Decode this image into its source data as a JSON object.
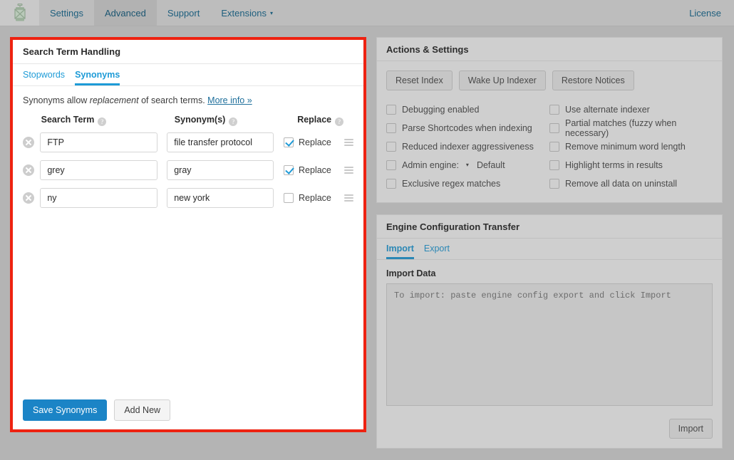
{
  "topbar": {
    "logo_icon": "lantern-icon",
    "tabs": [
      {
        "label": "Settings",
        "active": false
      },
      {
        "label": "Advanced",
        "active": true
      },
      {
        "label": "Support",
        "active": false
      },
      {
        "label": "Extensions",
        "active": false,
        "caret": "▾"
      }
    ],
    "license_label": "License"
  },
  "left_panel": {
    "title": "Search Term Handling",
    "subtabs": [
      {
        "label": "Stopwords",
        "active": false
      },
      {
        "label": "Synonyms",
        "active": true
      }
    ],
    "description_before": "Synonyms allow ",
    "description_em": "replacement",
    "description_after": " of search terms. ",
    "more_info_label": "More info »",
    "columns": {
      "term": "Search Term",
      "synonym": "Synonym(s)",
      "replace": "Replace",
      "help_glyph": "?"
    },
    "rows": [
      {
        "term": "FTP",
        "synonym": "file transfer protocol",
        "replace_label": "Replace",
        "replace_checked": true,
        "remove_icon": "remove-circle-icon",
        "drag_icon": "drag-handle-icon"
      },
      {
        "term": "grey",
        "synonym": "gray",
        "replace_label": "Replace",
        "replace_checked": true,
        "remove_icon": "remove-circle-icon",
        "drag_icon": "drag-handle-icon"
      },
      {
        "term": "ny",
        "synonym": "new york",
        "replace_label": "Replace",
        "replace_checked": false,
        "remove_icon": "remove-circle-icon",
        "drag_icon": "drag-handle-icon"
      }
    ],
    "save_label": "Save Synonyms",
    "add_new_label": "Add New"
  },
  "actions_panel": {
    "title": "Actions & Settings",
    "buttons": [
      {
        "label": "Reset Index"
      },
      {
        "label": "Wake Up Indexer"
      },
      {
        "label": "Restore Notices"
      }
    ],
    "options_left": [
      {
        "label": "Debugging enabled",
        "checked": false
      },
      {
        "label": "Parse Shortcodes when indexing",
        "checked": false
      },
      {
        "label": "Reduced indexer aggressiveness",
        "checked": false
      },
      {
        "label": "Admin engine:",
        "checked": false,
        "caret": "▾",
        "value": "Default"
      },
      {
        "label": "Exclusive regex matches",
        "checked": false
      }
    ],
    "options_right": [
      {
        "label": "Use alternate indexer",
        "checked": false
      },
      {
        "label": "Partial matches (fuzzy when necessary)",
        "checked": false
      },
      {
        "label": "Remove minimum word length",
        "checked": false
      },
      {
        "label": "Highlight terms in results",
        "checked": false
      },
      {
        "label": "Remove all data on uninstall",
        "checked": false
      }
    ]
  },
  "transfer_panel": {
    "title": "Engine Configuration Transfer",
    "subtabs": [
      {
        "label": "Import",
        "active": true
      },
      {
        "label": "Export",
        "active": false
      }
    ],
    "import_data_label": "Import Data",
    "textarea_value": "",
    "textarea_placeholder": "To import: paste engine config export and click Import",
    "import_button_label": "Import"
  },
  "colors": {
    "page_bg": "#b4b4b4",
    "highlight_border": "#ee2211",
    "accent_blue": "#1e9bd7",
    "primary_button": "#1b84c6",
    "nav_link": "#1e5f7e"
  }
}
